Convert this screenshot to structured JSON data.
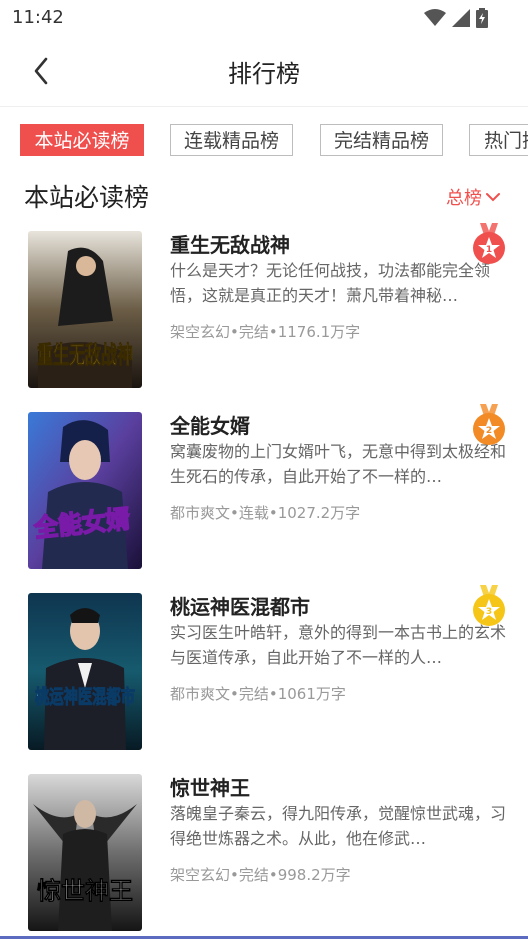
{
  "status": {
    "time": "11:42"
  },
  "header": {
    "title": "排行榜"
  },
  "tabs": [
    {
      "label": "本站必读榜",
      "active": true
    },
    {
      "label": "连载精品榜",
      "active": false
    },
    {
      "label": "完结精品榜",
      "active": false
    },
    {
      "label": "热门搜",
      "active": false
    }
  ],
  "section": {
    "title": "本站必读榜",
    "link_label": "总榜"
  },
  "books": [
    {
      "title": "重生无敌战神",
      "desc": "什么是天才？无论任何战技，功法都能完全领悟，这就是真正的天才！萧凡带着神秘…",
      "meta": "架空玄幻•完结•1176.1万字",
      "cover_text": "重生无敌战神",
      "rank_color": "#f0504d"
    },
    {
      "title": "全能女婿",
      "desc": "窝囊废物的上门女婿叶飞，无意中得到太极经和生死石的传承，自此开始了不一样的…",
      "meta": "都市爽文•连载•1027.2万字",
      "cover_text": "全能女婿",
      "rank_color": "#f28a25"
    },
    {
      "title": "桃运神医混都市",
      "desc": "实习医生叶皓轩，意外的得到一本古书上的玄术与医道传承，自此开始了不一样的人…",
      "meta": "都市爽文•完结•1061万字",
      "cover_text": "桃运神医混都市",
      "rank_color": "#f5c518"
    },
    {
      "title": "惊世神王",
      "desc": "落魄皇子秦云，得九阳传承，觉醒惊世武魂，习得绝世炼器之术。从此，他在修武…",
      "meta": "架空玄幻•完结•998.2万字",
      "cover_text": "惊世神王",
      "rank_color": ""
    }
  ]
}
